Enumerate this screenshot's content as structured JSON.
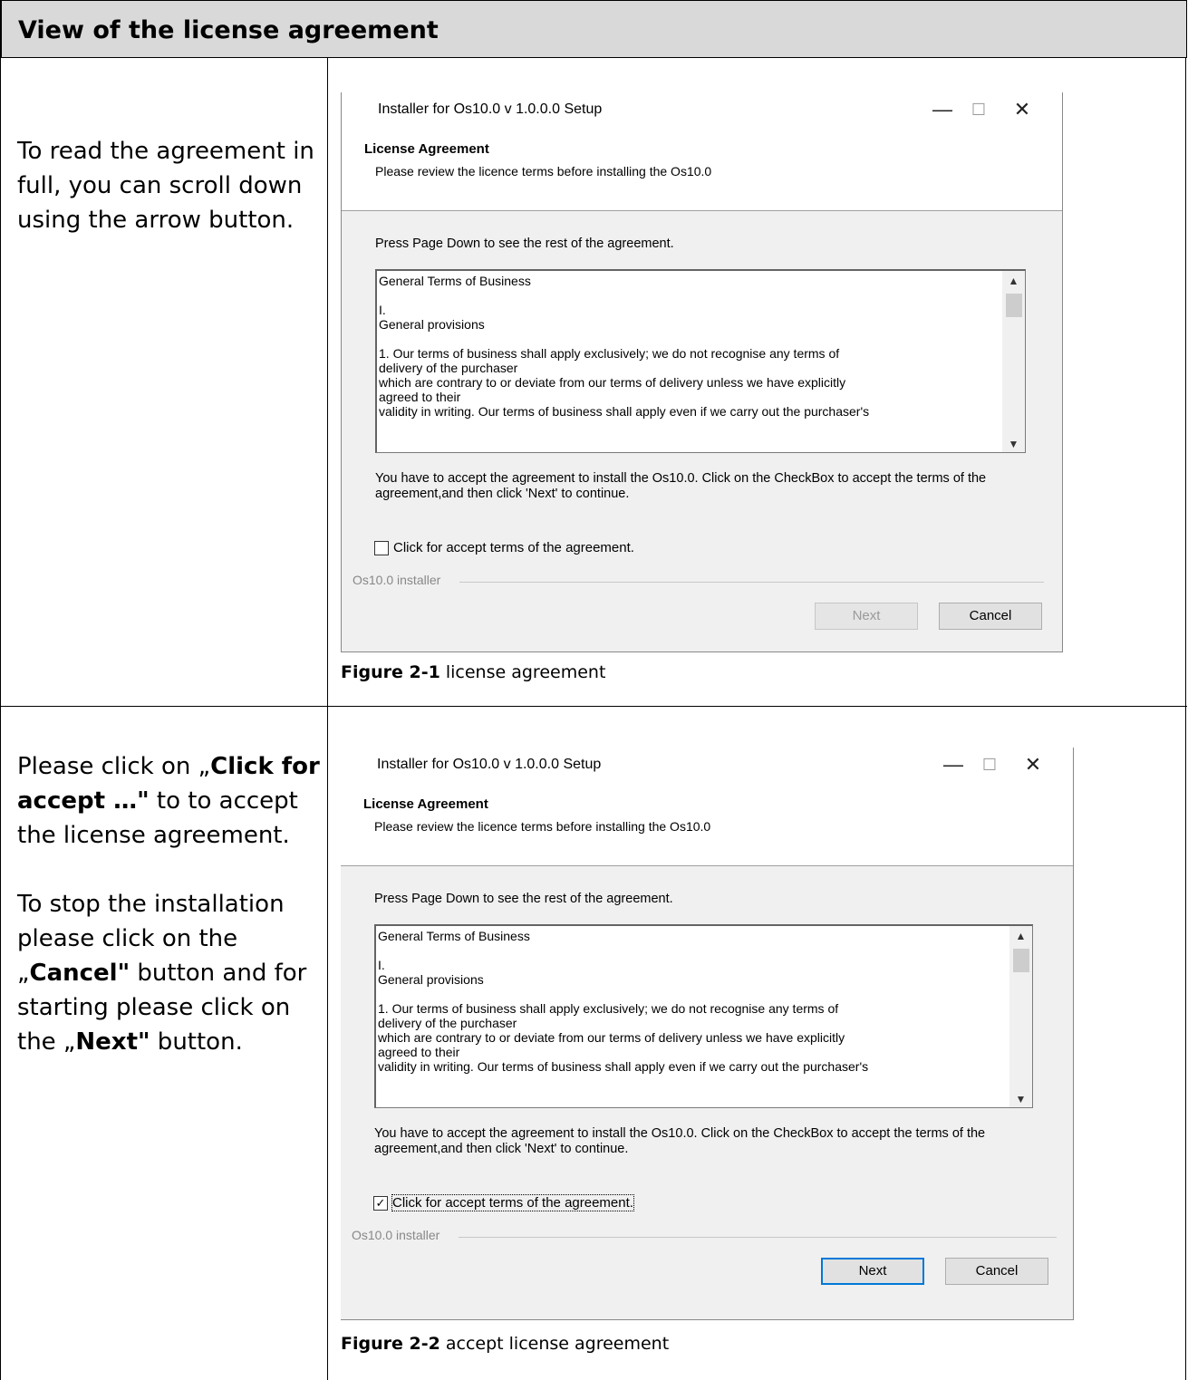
{
  "section_title": "View of the license agreement",
  "row1": {
    "instruction": "To read the agreement in full, you can scroll down using the arrow button.",
    "caption_label": "Figure 2-1",
    "caption_text": " license agreement"
  },
  "row2": {
    "p1_pre": "Please click on „",
    "p1_bold": "Click for accept …\"",
    "p1_post": " to to accept the license agreement.",
    "p2_pre": "To stop the installation please click on the „",
    "p2_bold1": "Cancel\"",
    "p2_mid": " button and for starting please click on the „",
    "p2_bold2": "Next\"",
    "p2_post": " button.",
    "caption_label": "Figure 2-2",
    "caption_text": " accept license agreement"
  },
  "dialog": {
    "title": "Installer for Os10.0 v 1.0.0.0 Setup",
    "minimize": "—",
    "maximize": "☐",
    "close": "✕",
    "section_heading": "License Agreement",
    "section_sub": "Please review the licence terms before installing the Os10.0",
    "page_down_hint": "Press Page Down to see the rest of the agreement.",
    "license_lines": [
      "General Terms of Business",
      "",
      "I.",
      "General provisions",
      "",
      "1. Our terms of business shall apply exclusively; we do not recognise any terms of",
      "delivery of the purchaser",
      "which are contrary to or deviate from our terms of delivery unless we have explicitly",
      "agreed to their",
      "validity in writing. Our terms of business shall apply even if we carry out the purchaser's"
    ],
    "accept_note": "You have to accept the agreement to install the Os10.0. Click on the CheckBox to accept the terms of the agreement,and then  click 'Next' to continue.",
    "checkbox_label": "Click for accept terms of the agreement.",
    "brand": "Os10.0 installer",
    "next_label": "Next",
    "cancel_label": "Cancel"
  },
  "dialog1_state": {
    "checked": false,
    "next_enabled": false
  },
  "dialog2_state": {
    "checked": true,
    "next_enabled": true
  }
}
